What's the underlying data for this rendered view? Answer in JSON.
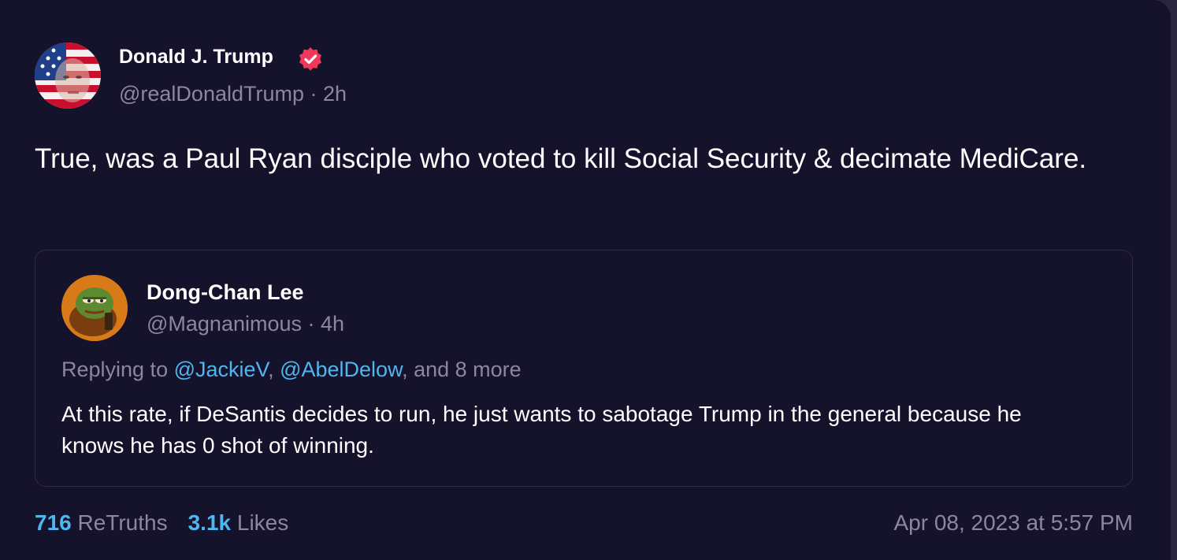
{
  "post": {
    "author_name": "Donald J. Trump",
    "handle": "@realDonaldTrump",
    "separator": " · ",
    "time_ago": "2h",
    "text": "True, was a Paul Ryan disciple who voted to kill Social Security & decimate MediCare."
  },
  "quote": {
    "author_name": "Dong-Chan Lee",
    "handle": "@Magnanimous",
    "separator": " · ",
    "time_ago": "4h",
    "replying_prefix": "Replying to ",
    "mention_1": "@JackieV",
    "comma": ", ",
    "mention_2": "@AbelDelow",
    "replying_suffix": ", and 8 more",
    "text": "At this rate, if DeSantis decides to run, he just wants to sabotage Trump in the general because he knows he has 0 shot of winning."
  },
  "stats": {
    "retruths_count": "716",
    "retruths_label": " ReTruths",
    "likes_count": "3.1k",
    "likes_label": " Likes"
  },
  "timestamp": "Apr 08, 2023 at 5:57 PM",
  "icons": {
    "verified": "verified-badge-icon"
  },
  "colors": {
    "background": "#15122c",
    "accent": "#4fb6ee",
    "verified": "#f2385a",
    "muted": "#8a879e"
  }
}
